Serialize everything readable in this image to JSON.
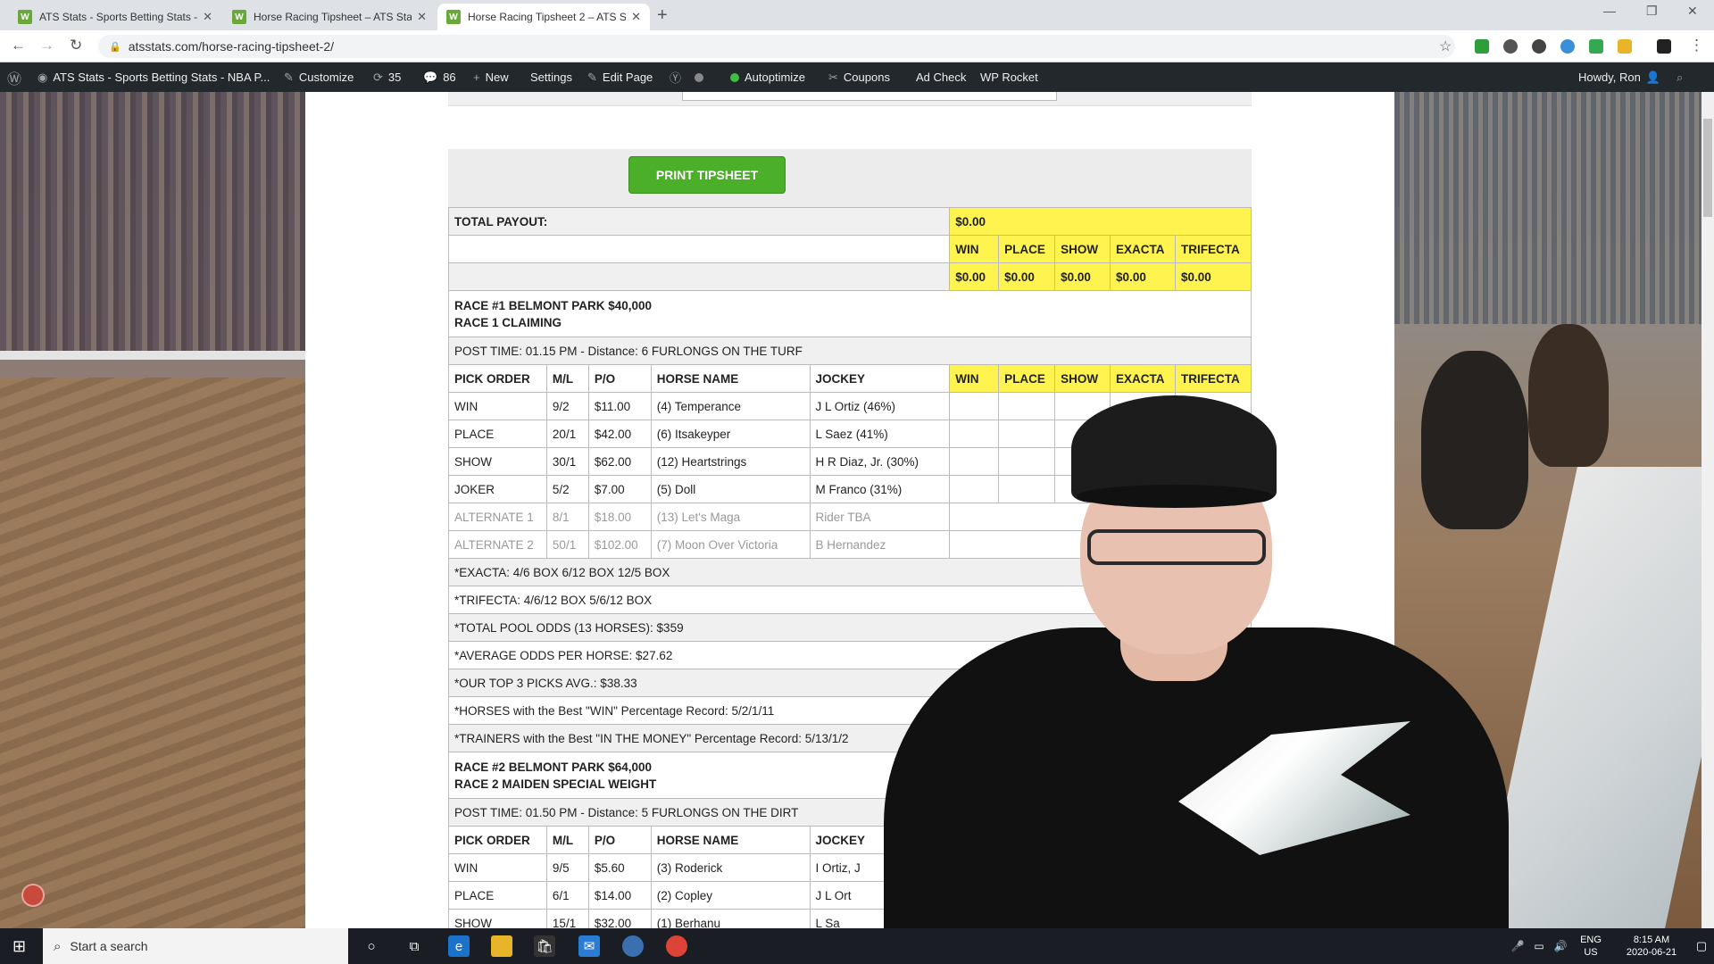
{
  "browser": {
    "tabs": [
      {
        "title": "ATS Stats - Sports Betting Stats -",
        "active": false
      },
      {
        "title": "Horse Racing Tipsheet – ATS Stat",
        "active": false
      },
      {
        "title": "Horse Racing Tipsheet 2 – ATS St",
        "active": true
      }
    ],
    "url": "atsstats.com/horse-racing-tipsheet-2/"
  },
  "adminbar": {
    "site": "ATS Stats - Sports Betting Stats - NBA P...",
    "customize": "Customize",
    "updates": "35",
    "comments": "86",
    "new": "New",
    "settings": "Settings",
    "edit_page": "Edit Page",
    "autoptimize": "Autoptimize",
    "coupons": "Coupons",
    "ad_check": "Ad Check",
    "wp_rocket": "WP Rocket",
    "howdy": "Howdy, Ron"
  },
  "page": {
    "print_button": "PRINT TIPSHEET",
    "total_payout_label": "TOTAL PAYOUT:",
    "total_payout_value": "$0.00",
    "payout_headers": [
      "WIN",
      "PLACE",
      "SHOW",
      "EXACTA",
      "TRIFECTA"
    ],
    "payout_values": [
      "$0.00",
      "$0.00",
      "$0.00",
      "$0.00",
      "$0.00"
    ],
    "pick_headers": [
      "PICK ORDER",
      "M/L",
      "P/O",
      "HORSE NAME",
      "JOCKEY",
      "WIN",
      "PLACE",
      "SHOW",
      "EXACTA",
      "TRIFECTA"
    ],
    "race1": {
      "line1": "RACE #1 BELMONT PARK $40,000",
      "line2": "RACE 1 CLAIMING",
      "post_time": "POST TIME: 01.15 PM - Distance: 6 FURLONGS ON THE TURF",
      "rows": [
        {
          "pick": "WIN",
          "ml": "9/2",
          "po": "$11.00",
          "horse": "(4) Temperance",
          "jockey": "J L Ortiz (46%)"
        },
        {
          "pick": "PLACE",
          "ml": "20/1",
          "po": "$42.00",
          "horse": "(6) Itsakeyper",
          "jockey": "L Saez (41%)"
        },
        {
          "pick": "SHOW",
          "ml": "30/1",
          "po": "$62.00",
          "horse": "(12) Heartstrings",
          "jockey": "H R Diaz, Jr. (30%)"
        },
        {
          "pick": "JOKER",
          "ml": "5/2",
          "po": "$7.00",
          "horse": "(5) Doll",
          "jockey": "M Franco (31%)"
        }
      ],
      "alternates": [
        {
          "pick": "ALTERNATE 1",
          "ml": "8/1",
          "po": "$18.00",
          "horse": "(13) Let's Maga",
          "jockey": "Rider TBA"
        },
        {
          "pick": "ALTERNATE 2",
          "ml": "50/1",
          "po": "$102.00",
          "horse": "(7) Moon Over Victoria",
          "jockey": "B Hernandez"
        }
      ],
      "notes": [
        "*EXACTA: 4/6 BOX 6/12 BOX 12/5 BOX",
        "*TRIFECTA: 4/6/12 BOX 5/6/12 BOX",
        "*TOTAL POOL ODDS (13 HORSES): $359",
        "*AVERAGE ODDS PER HORSE: $27.62",
        "*OUR TOP 3 PICKS AVG.: $38.33",
        "*HORSES with the Best \"WIN\" Percentage Record: 5/2/1/11",
        "*TRAINERS with the Best \"IN THE MONEY\" Percentage Record: 5/13/1/2"
      ]
    },
    "race2": {
      "line1": "RACE #2 BELMONT PARK $64,000",
      "line2": "RACE 2 MAIDEN SPECIAL WEIGHT",
      "post_time": "POST TIME: 01.50 PM - Distance: 5 FURLONGS ON THE DIRT",
      "rows": [
        {
          "pick": "WIN",
          "ml": "9/5",
          "po": "$5.60",
          "horse": "(3) Roderick",
          "jockey": "I Ortiz, J"
        },
        {
          "pick": "PLACE",
          "ml": "6/1",
          "po": "$14.00",
          "horse": "(2) Copley",
          "jockey": "J L Ort"
        },
        {
          "pick": "SHOW",
          "ml": "15/1",
          "po": "$32.00",
          "horse": "(1) Berhanu",
          "jockey": "L Sa"
        }
      ]
    }
  },
  "taskbar": {
    "search_placeholder": "Start a search",
    "lang": "ENG",
    "region": "US",
    "time": "8:15 AM",
    "date": "2020-06-21"
  },
  "colors": {
    "print_button": "#4caf2a",
    "payout_highlight": "#fff44f",
    "admin_bar": "#23282d"
  }
}
